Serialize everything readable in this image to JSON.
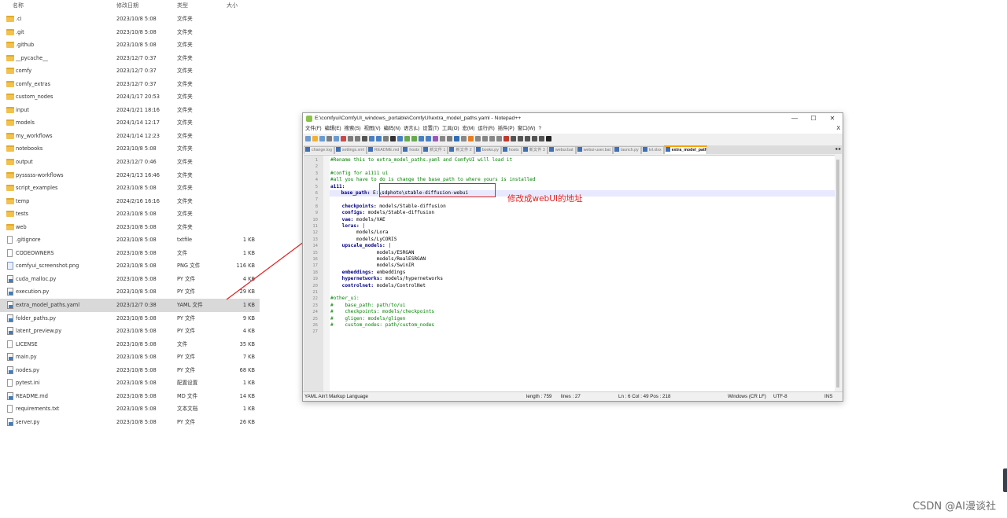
{
  "explorer": {
    "headers": {
      "name": "名称",
      "date": "修改日期",
      "type": "类型",
      "size": "大小"
    },
    "rows": [
      {
        "name": ".ci",
        "date": "2023/10/8 5:08",
        "type": "文件夹",
        "size": "",
        "icon": "folder-icon"
      },
      {
        "name": ".git",
        "date": "2023/10/8 5:08",
        "type": "文件夹",
        "size": "",
        "icon": "folder-icon"
      },
      {
        "name": ".github",
        "date": "2023/10/8 5:08",
        "type": "文件夹",
        "size": "",
        "icon": "folder-icon"
      },
      {
        "name": "__pycache__",
        "date": "2023/12/7 0:37",
        "type": "文件夹",
        "size": "",
        "icon": "folder-icon"
      },
      {
        "name": "comfy",
        "date": "2023/12/7 0:37",
        "type": "文件夹",
        "size": "",
        "icon": "folder-icon"
      },
      {
        "name": "comfy_extras",
        "date": "2023/12/7 0:37",
        "type": "文件夹",
        "size": "",
        "icon": "folder-icon"
      },
      {
        "name": "custom_nodes",
        "date": "2024/1/17 20:53",
        "type": "文件夹",
        "size": "",
        "icon": "folder-icon"
      },
      {
        "name": "input",
        "date": "2024/1/21 18:16",
        "type": "文件夹",
        "size": "",
        "icon": "folder-icon"
      },
      {
        "name": "models",
        "date": "2024/1/14 12:17",
        "type": "文件夹",
        "size": "",
        "icon": "folder-icon"
      },
      {
        "name": "my_workflows",
        "date": "2024/1/14 12:23",
        "type": "文件夹",
        "size": "",
        "icon": "folder-icon"
      },
      {
        "name": "notebooks",
        "date": "2023/10/8 5:08",
        "type": "文件夹",
        "size": "",
        "icon": "folder-icon"
      },
      {
        "name": "output",
        "date": "2023/12/7 0:46",
        "type": "文件夹",
        "size": "",
        "icon": "folder-icon"
      },
      {
        "name": "pysssss-workflows",
        "date": "2024/1/13 16:46",
        "type": "文件夹",
        "size": "",
        "icon": "folder-icon"
      },
      {
        "name": "script_examples",
        "date": "2023/10/8 5:08",
        "type": "文件夹",
        "size": "",
        "icon": "folder-icon"
      },
      {
        "name": "temp",
        "date": "2024/2/16 16:16",
        "type": "文件夹",
        "size": "",
        "icon": "folder-icon"
      },
      {
        "name": "tests",
        "date": "2023/10/8 5:08",
        "type": "文件夹",
        "size": "",
        "icon": "folder-icon"
      },
      {
        "name": "web",
        "date": "2023/10/8 5:08",
        "type": "文件夹",
        "size": "",
        "icon": "folder-icon"
      },
      {
        "name": ".gitignore",
        "date": "2023/10/8 5:08",
        "type": "txtfile",
        "size": "1 KB",
        "icon": "file-icon"
      },
      {
        "name": "CODEOWNERS",
        "date": "2023/10/8 5:08",
        "type": "文件",
        "size": "1 KB",
        "icon": "file-icon"
      },
      {
        "name": "comfyui_screenshot.png",
        "date": "2023/10/8 5:08",
        "type": "PNG 文件",
        "size": "116 KB",
        "icon": "image-file-icon"
      },
      {
        "name": "cuda_malloc.py",
        "date": "2023/10/8 5:08",
        "type": "PY 文件",
        "size": "4 KB",
        "icon": "python-file-icon"
      },
      {
        "name": "execution.py",
        "date": "2023/10/8 5:08",
        "type": "PY 文件",
        "size": "29 KB",
        "icon": "python-file-icon"
      },
      {
        "name": "extra_model_paths.yaml",
        "date": "2023/12/7 0:38",
        "type": "YAML 文件",
        "size": "1 KB",
        "icon": "notepad-file-icon",
        "selected": true
      },
      {
        "name": "folder_paths.py",
        "date": "2023/10/8 5:08",
        "type": "PY 文件",
        "size": "9 KB",
        "icon": "python-file-icon"
      },
      {
        "name": "latent_preview.py",
        "date": "2023/10/8 5:08",
        "type": "PY 文件",
        "size": "4 KB",
        "icon": "python-file-icon"
      },
      {
        "name": "LICENSE",
        "date": "2023/10/8 5:08",
        "type": "文件",
        "size": "35 KB",
        "icon": "file-icon"
      },
      {
        "name": "main.py",
        "date": "2023/10/8 5:08",
        "type": "PY 文件",
        "size": "7 KB",
        "icon": "python-file-icon"
      },
      {
        "name": "nodes.py",
        "date": "2023/10/8 5:08",
        "type": "PY 文件",
        "size": "68 KB",
        "icon": "python-file-icon"
      },
      {
        "name": "pytest.ini",
        "date": "2023/10/8 5:08",
        "type": "配置设置",
        "size": "1 KB",
        "icon": "settings-file-icon"
      },
      {
        "name": "README.md",
        "date": "2023/10/8 5:08",
        "type": "MD 文件",
        "size": "14 KB",
        "icon": "python-file-icon"
      },
      {
        "name": "requirements.txt",
        "date": "2023/10/8 5:08",
        "type": "文本文档",
        "size": "1 KB",
        "icon": "file-icon"
      },
      {
        "name": "server.py",
        "date": "2023/10/8 5:08",
        "type": "PY 文件",
        "size": "26 KB",
        "icon": "python-file-icon"
      }
    ]
  },
  "notepad": {
    "title": "E:\\comfyui\\ComfyUI_windows_portable\\ComfyUI\\extra_model_paths.yaml - Notepad++",
    "window_buttons": {
      "minimize": "—",
      "maximize": "☐",
      "close": "✕"
    },
    "menu": [
      "文件(F)",
      "编辑(E)",
      "搜索(S)",
      "视图(V)",
      "编码(N)",
      "语言(L)",
      "设置(T)",
      "工具(O)",
      "宏(M)",
      "运行(R)",
      "插件(P)",
      "窗口(W)",
      "?"
    ],
    "menu_close": "X",
    "tabs": [
      {
        "label": "change.log"
      },
      {
        "label": "settings.xml"
      },
      {
        "label": "README.md"
      },
      {
        "label": "hosts"
      },
      {
        "label": "新文件 1"
      },
      {
        "label": "新文件 2"
      },
      {
        "label": "books.py"
      },
      {
        "label": "hosts"
      },
      {
        "label": "新文件 3"
      },
      {
        "label": "webui.bat"
      },
      {
        "label": "webui-user.bat"
      },
      {
        "label": "launch.py"
      },
      {
        "label": "tvl.xlsx"
      },
      {
        "label": "extra_model_paths.yaml",
        "active": true
      }
    ],
    "tab_scroll": "◂ ▸",
    "code_lines": [
      {
        "n": "1",
        "text": "#Rename this to extra_model_paths.yaml and ComfyUI will load it",
        "kind": "cm"
      },
      {
        "n": "2",
        "text": "",
        "kind": "vl"
      },
      {
        "n": "3",
        "text": "#config for a1111 ui",
        "kind": "cm"
      },
      {
        "n": "4",
        "text": "#all you have to do is change the base_path to where yours is installed",
        "kind": "cm"
      },
      {
        "n": "5",
        "text": "a111:",
        "kind": "ky",
        "fold": true
      },
      {
        "n": "6",
        "text": "    base_path: E:\\sdphoto\\stable-diffusion-webui",
        "kind": "kv",
        "key": "    base_path:",
        "val": " E:\\sdphoto\\stable-diffusion-webui",
        "active": true
      },
      {
        "n": "7",
        "text": "",
        "kind": "vl"
      },
      {
        "n": "8",
        "text": "    checkpoints: models/Stable-diffusion",
        "kind": "kv",
        "key": "    checkpoints:",
        "val": " models/Stable-diffusion"
      },
      {
        "n": "9",
        "text": "    configs: models/Stable-diffusion",
        "kind": "kv",
        "key": "    configs:",
        "val": " models/Stable-diffusion"
      },
      {
        "n": "10",
        "text": "    vae: models/VAE",
        "kind": "kv",
        "key": "    vae:",
        "val": " models/VAE"
      },
      {
        "n": "11",
        "text": "    loras: |",
        "kind": "kv",
        "key": "    loras:",
        "val": " |",
        "fold": true
      },
      {
        "n": "12",
        "text": "         models/Lora",
        "kind": "sc"
      },
      {
        "n": "13",
        "text": "         models/LyCORIS",
        "kind": "sc"
      },
      {
        "n": "14",
        "text": "    upscale_models: |",
        "kind": "kv",
        "key": "    upscale_models:",
        "val": " |",
        "fold": true
      },
      {
        "n": "15",
        "text": "                models/ESRGAN",
        "kind": "sc"
      },
      {
        "n": "16",
        "text": "                models/RealESRGAN",
        "kind": "sc"
      },
      {
        "n": "17",
        "text": "                models/SwinIR",
        "kind": "sc"
      },
      {
        "n": "18",
        "text": "    embeddings: embeddings",
        "kind": "kv",
        "key": "    embeddings:",
        "val": " embeddings"
      },
      {
        "n": "19",
        "text": "    hypernetworks: models/hypernetworks",
        "kind": "kv",
        "key": "    hypernetworks:",
        "val": " models/hypernetworks"
      },
      {
        "n": "20",
        "text": "    controlnet: models/ControlNet",
        "kind": "kv",
        "key": "    controlnet:",
        "val": " models/ControlNet"
      },
      {
        "n": "21",
        "text": "",
        "kind": "vl"
      },
      {
        "n": "22",
        "text": "#other_ui:",
        "kind": "cm"
      },
      {
        "n": "23",
        "text": "#    base_path: path/to/ui",
        "kind": "cm"
      },
      {
        "n": "24",
        "text": "#    checkpoints: models/checkpoints",
        "kind": "cm"
      },
      {
        "n": "25",
        "text": "#    gligen: models/gligen",
        "kind": "cm"
      },
      {
        "n": "26",
        "text": "#    custom_nodes: path/custom_nodes",
        "kind": "cm"
      },
      {
        "n": "27",
        "text": "",
        "kind": "vl"
      }
    ],
    "status": {
      "language": "YAML Ain't Markup Language",
      "length": "length : 759",
      "lines": "lines : 27",
      "position": "Ln : 6    Col : 49    Pos : 218",
      "eol": "Windows (CR LF)",
      "encoding": "UTF-8",
      "mode": "INS"
    }
  },
  "annotation": {
    "text": "修改成webUI的地址",
    "color": "#e02020"
  },
  "watermark": "CSDN @AI漫谈社",
  "colors": {
    "folder": "#f2c14e",
    "selection": "#d9d9d9",
    "comment": "#008000",
    "key": "#000080",
    "active_line": "#e8e8ff",
    "tab_accent": "#f7a400"
  }
}
